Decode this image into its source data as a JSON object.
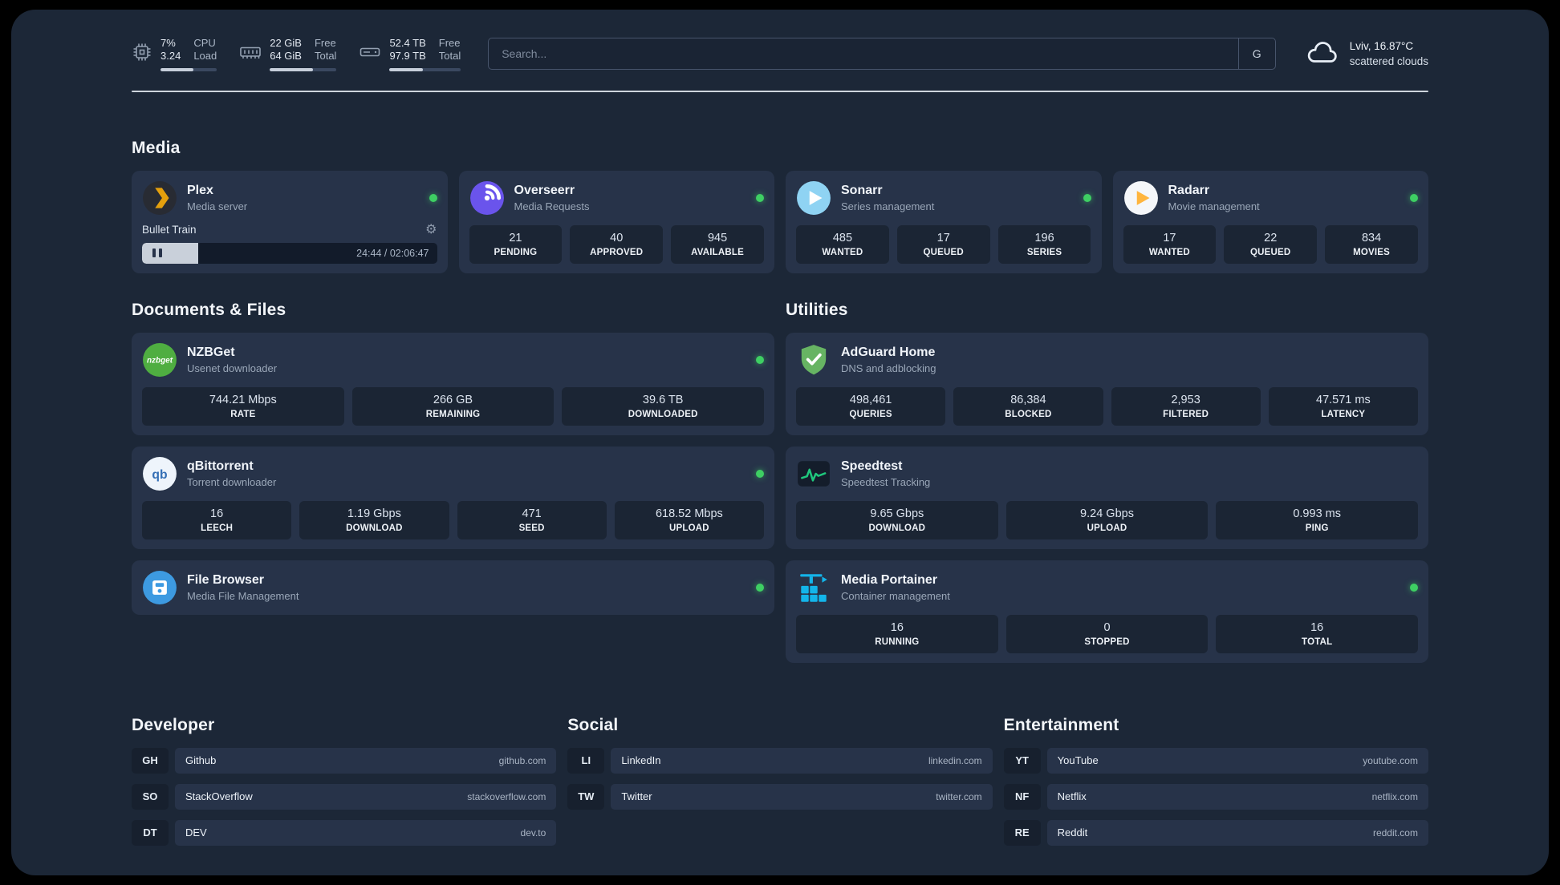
{
  "theme": {
    "background": "#1c2737",
    "card": "#273349",
    "stat_box": "#1b2534",
    "status_online": "#3ecf63",
    "divider": "#dde4ec",
    "text_primary": "#eef3f9",
    "text_secondary": "#9aa7b8"
  },
  "topbar": {
    "cpu": {
      "value": "7%",
      "load": "3.24",
      "label_top": "CPU",
      "label_bottom": "Load",
      "bar_percent": 58
    },
    "ram": {
      "free": "22 GiB",
      "total": "64 GiB",
      "label_top": "Free",
      "label_bottom": "Total",
      "bar_percent": 65
    },
    "disk": {
      "free": "52.4 TB",
      "total": "97.9 TB",
      "label_top": "Free",
      "label_bottom": "Total",
      "bar_percent": 47
    },
    "search": {
      "placeholder": "Search...",
      "provider_label": "G"
    },
    "weather": {
      "location": "Lviv, 16.87°C",
      "condition": "scattered clouds"
    }
  },
  "sections": {
    "media": "Media",
    "documents": "Documents & Files",
    "utilities": "Utilities",
    "developer": "Developer",
    "social": "Social",
    "entertainment": "Entertainment"
  },
  "icons": {
    "gear": "⚙",
    "nzbget_label": "nzbget",
    "qb_label": "qb"
  },
  "apps": {
    "plex": {
      "name": "Plex",
      "subtitle": "Media server",
      "status": "online",
      "player": {
        "track": "Bullet Train",
        "time": "24:44 / 02:06:47",
        "progress_percent": 19
      }
    },
    "overseerr": {
      "name": "Overseerr",
      "subtitle": "Media Requests",
      "status": "online",
      "stats": [
        {
          "value": "21",
          "label": "PENDING"
        },
        {
          "value": "40",
          "label": "APPROVED"
        },
        {
          "value": "945",
          "label": "AVAILABLE"
        }
      ]
    },
    "sonarr": {
      "name": "Sonarr",
      "subtitle": "Series management",
      "status": "online",
      "stats": [
        {
          "value": "485",
          "label": "WANTED"
        },
        {
          "value": "17",
          "label": "QUEUED"
        },
        {
          "value": "196",
          "label": "SERIES"
        }
      ]
    },
    "radarr": {
      "name": "Radarr",
      "subtitle": "Movie management",
      "status": "online",
      "stats": [
        {
          "value": "17",
          "label": "WANTED"
        },
        {
          "value": "22",
          "label": "QUEUED"
        },
        {
          "value": "834",
          "label": "MOVIES"
        }
      ]
    },
    "nzbget": {
      "name": "NZBGet",
      "subtitle": "Usenet downloader",
      "status": "online",
      "stats": [
        {
          "value": "744.21 Mbps",
          "label": "RATE"
        },
        {
          "value": "266 GB",
          "label": "REMAINING"
        },
        {
          "value": "39.6 TB",
          "label": "DOWNLOADED"
        }
      ]
    },
    "qbittorrent": {
      "name": "qBittorrent",
      "subtitle": "Torrent downloader",
      "status": "online",
      "stats": [
        {
          "value": "16",
          "label": "LEECH"
        },
        {
          "value": "1.19 Gbps",
          "label": "DOWNLOAD"
        },
        {
          "value": "471",
          "label": "SEED"
        },
        {
          "value": "618.52 Mbps",
          "label": "UPLOAD"
        }
      ]
    },
    "filebrowser": {
      "name": "File Browser",
      "subtitle": "Media File Management",
      "status": "online"
    },
    "adguard": {
      "name": "AdGuard Home",
      "subtitle": "DNS and adblocking",
      "stats": [
        {
          "value": "498,461",
          "label": "QUERIES"
        },
        {
          "value": "86,384",
          "label": "BLOCKED"
        },
        {
          "value": "2,953",
          "label": "FILTERED"
        },
        {
          "value": "47.571 ms",
          "label": "LATENCY"
        }
      ]
    },
    "speedtest": {
      "name": "Speedtest",
      "subtitle": "Speedtest Tracking",
      "stats": [
        {
          "value": "9.65 Gbps",
          "label": "DOWNLOAD"
        },
        {
          "value": "9.24 Gbps",
          "label": "UPLOAD"
        },
        {
          "value": "0.993 ms",
          "label": "PING"
        }
      ]
    },
    "portainer": {
      "name": "Media Portainer",
      "subtitle": "Container management",
      "status": "online",
      "stats": [
        {
          "value": "16",
          "label": "RUNNING"
        },
        {
          "value": "0",
          "label": "STOPPED"
        },
        {
          "value": "16",
          "label": "TOTAL"
        }
      ]
    }
  },
  "bookmarks": {
    "developer": [
      {
        "abbr": "GH",
        "name": "Github",
        "url": "github.com"
      },
      {
        "abbr": "SO",
        "name": "StackOverflow",
        "url": "stackoverflow.com"
      },
      {
        "abbr": "DT",
        "name": "DEV",
        "url": "dev.to"
      }
    ],
    "social": [
      {
        "abbr": "LI",
        "name": "LinkedIn",
        "url": "linkedin.com"
      },
      {
        "abbr": "TW",
        "name": "Twitter",
        "url": "twitter.com"
      }
    ],
    "entertainment": [
      {
        "abbr": "YT",
        "name": "YouTube",
        "url": "youtube.com"
      },
      {
        "abbr": "NF",
        "name": "Netflix",
        "url": "netflix.com"
      },
      {
        "abbr": "RE",
        "name": "Reddit",
        "url": "reddit.com"
      }
    ]
  }
}
